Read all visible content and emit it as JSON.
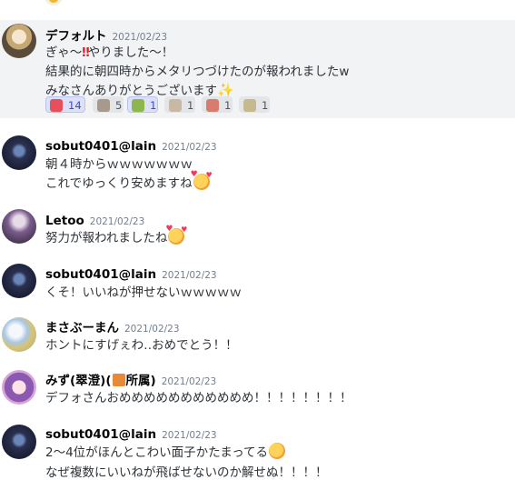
{
  "messages": [
    {
      "author": "デフォルト",
      "timestamp": "2021/02/23",
      "lines": [
        "ぎゃ～",
        "やりました～！",
        "結果的に朝四時からメタリつづけたのが報われましたw",
        "みなさんありがとうございます"
      ],
      "reactions": [
        {
          "icon": "party-popper-icon",
          "count": "14",
          "color": "#e6505a"
        },
        {
          "icon": "trophy-icon",
          "count": "5",
          "color": "#a79a8c"
        },
        {
          "icon": "sticker-icon",
          "count": "1",
          "color": "#8db74d"
        },
        {
          "icon": "sticker-icon",
          "count": "1",
          "color": "#c9b8a4"
        },
        {
          "icon": "sticker-icon",
          "count": "1",
          "color": "#d87c6c"
        },
        {
          "icon": "sticker-icon",
          "count": "1",
          "color": "#c7b98e"
        }
      ]
    },
    {
      "author": "sobut0401@lain",
      "timestamp": "2021/02/23",
      "lines": [
        "朝４時からｗｗｗｗｗｗｗ",
        "これでゆっくり安めますね"
      ]
    },
    {
      "author": "Letoo",
      "timestamp": "2021/02/23",
      "lines": [
        "努力が報われましたね"
      ]
    },
    {
      "author": "sobut0401@lain",
      "timestamp": "2021/02/23",
      "lines": [
        "くそ！いいねが押せないｗｗｗｗｗ"
      ]
    },
    {
      "author": "まさぶーまん",
      "timestamp": "2021/02/23",
      "lines": [
        "ホントにすげぇわ‥おめでとう！！"
      ]
    },
    {
      "author_prefix": "みず(翠澄)(",
      "author_suffix": "所属)",
      "timestamp": "2021/02/23",
      "lines": [
        "デフォさんおめめめめめめめめめめめ！！！！！！！！"
      ]
    },
    {
      "author": "sobut0401@lain",
      "timestamp": "2021/02/23",
      "lines": [
        "2～4位がほんとこわい面子かたまってる",
        "なぜ複数にいいねが飛ばせないのか解せぬ！！！！"
      ]
    }
  ]
}
